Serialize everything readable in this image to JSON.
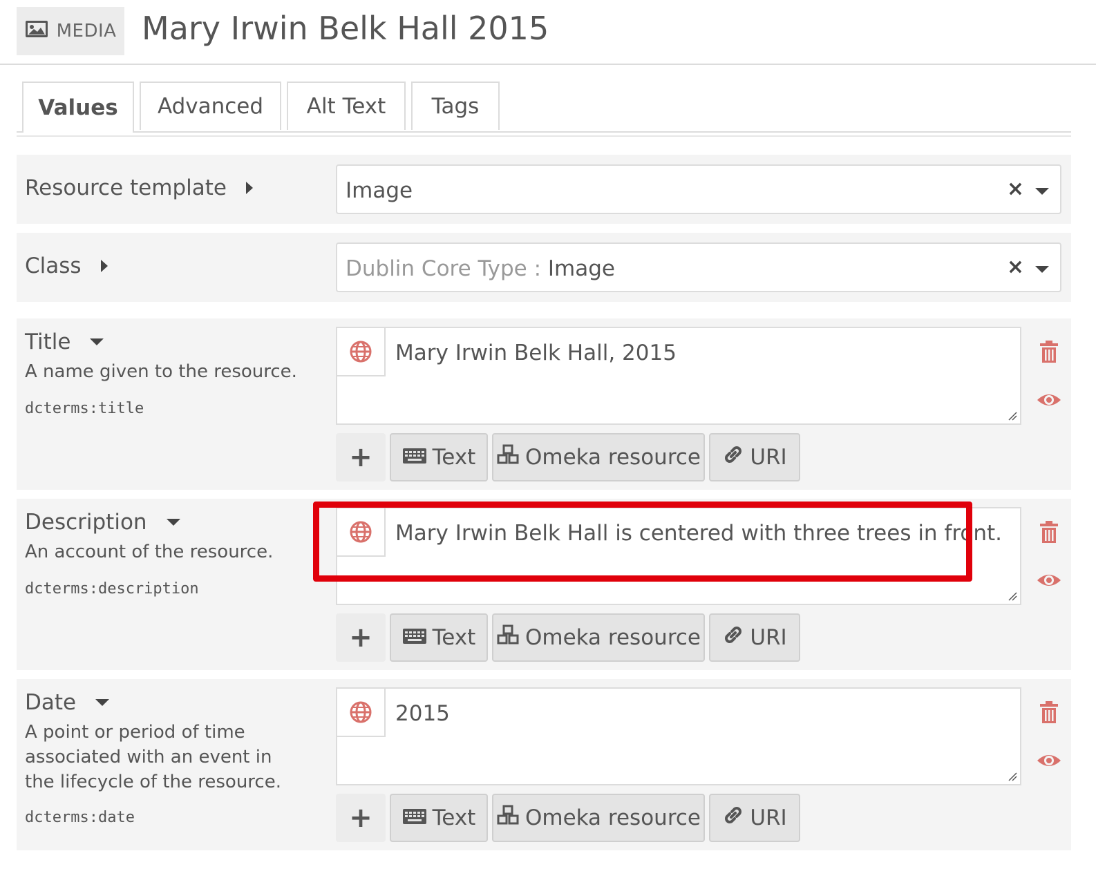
{
  "header": {
    "badge_label": "MEDIA",
    "badge_icon": "image-icon",
    "title": "Mary Irwin Belk Hall 2015"
  },
  "tabs": [
    {
      "label": "Values",
      "active": true
    },
    {
      "label": "Advanced",
      "active": false
    },
    {
      "label": "Alt Text",
      "active": false
    },
    {
      "label": "Tags",
      "active": false
    }
  ],
  "resource_template": {
    "label": "Resource template",
    "value": "Image"
  },
  "class": {
    "label": "Class",
    "prefix": "Dublin Core Type :",
    "value": "Image"
  },
  "properties": [
    {
      "label": "Title",
      "description": "A name given to the resource.",
      "term": "dcterms:title",
      "value": "Mary Irwin Belk Hall, 2015"
    },
    {
      "label": "Description",
      "description": "An account of the resource.",
      "term": "dcterms:description",
      "value": "Mary Irwin Belk Hall is centered with three trees in front."
    },
    {
      "label": "Date",
      "description": "A point or period of time associated with an event in the lifecycle of the resource.",
      "term": "dcterms:date",
      "value": "2015"
    }
  ],
  "value_buttons": {
    "add": "+",
    "text": "Text",
    "resource": "Omeka resource",
    "uri": "URI"
  },
  "colors": {
    "highlight": "#e0000a",
    "icon_red": "#d9716b",
    "panel_bg": "#f4f4f4"
  }
}
